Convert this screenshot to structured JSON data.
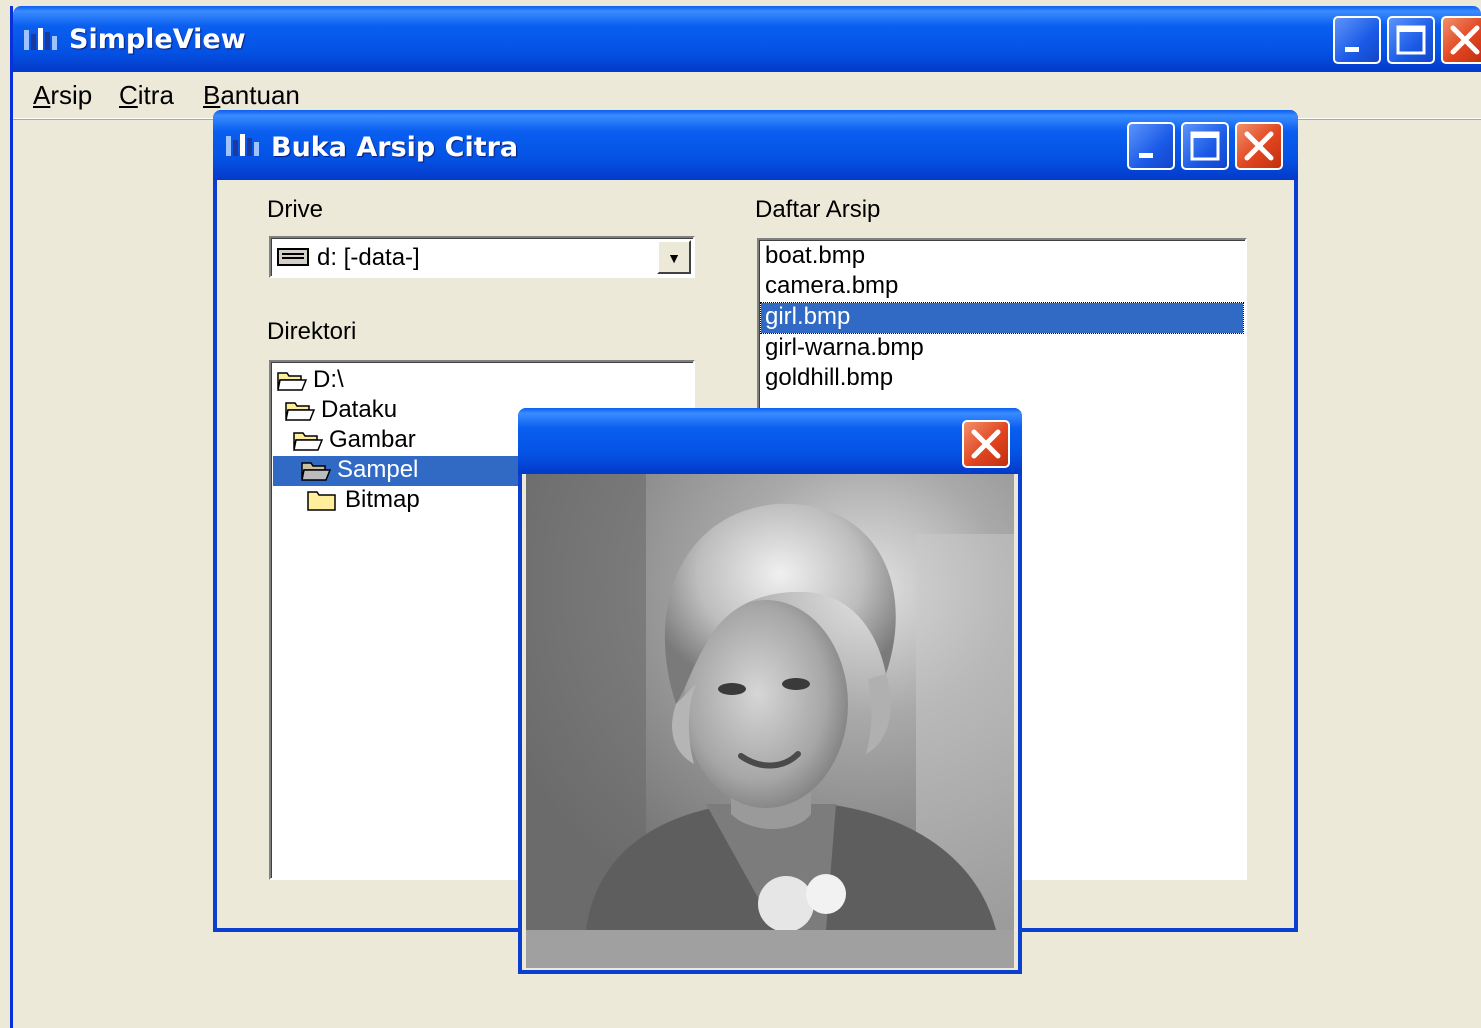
{
  "app": {
    "title": "SimpleView",
    "icon": "app-icon"
  },
  "menu": {
    "items": [
      {
        "label": "Arsip",
        "accel": "A",
        "rest": "rsip"
      },
      {
        "label": "Citra",
        "accel": "C",
        "rest": "itra"
      },
      {
        "label": "Bantuan",
        "accel": "B",
        "rest": "antuan"
      }
    ]
  },
  "dialog": {
    "title": "Buka Arsip Citra",
    "drive_label": "Drive",
    "drive_value": "d: [-data-]",
    "dir_label": "Direktori",
    "files_label": "Daftar Arsip",
    "directories": [
      {
        "name": "D:\\",
        "selected": false
      },
      {
        "name": "Dataku",
        "selected": false
      },
      {
        "name": "Gambar",
        "selected": false
      },
      {
        "name": "Sampel",
        "selected": true
      },
      {
        "name": "Bitmap",
        "selected": false
      }
    ],
    "files": [
      {
        "name": "boat.bmp",
        "selected": false
      },
      {
        "name": "camera.bmp",
        "selected": false
      },
      {
        "name": "girl.bmp",
        "selected": true
      },
      {
        "name": "girl-warna.bmp",
        "selected": false
      },
      {
        "name": "goldhill.bmp",
        "selected": false
      }
    ]
  },
  "preview": {
    "image": "grayscale-portrait-of-woman"
  },
  "colors": {
    "titlebar": "#0452e4",
    "selection": "#316ac5",
    "face": "#ece9d8",
    "close": "#e0451f"
  }
}
